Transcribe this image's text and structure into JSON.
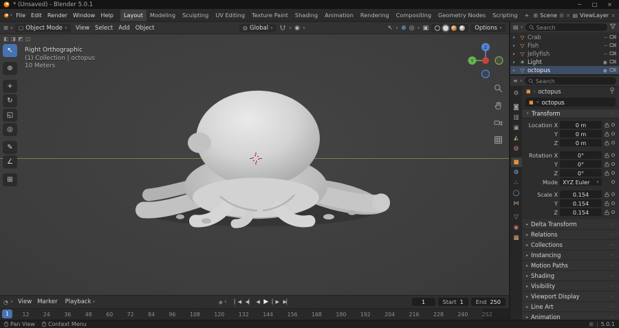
{
  "titlebar": {
    "title": "* (Unsaved) - Blender 5.0.1"
  },
  "menubar": {
    "menus": [
      {
        "label": "File"
      },
      {
        "label": "Edit"
      },
      {
        "label": "Render"
      },
      {
        "label": "Window"
      },
      {
        "label": "Help"
      }
    ],
    "workspaces": [
      {
        "label": "Layout",
        "active": true
      },
      {
        "label": "Modeling"
      },
      {
        "label": "Sculpting"
      },
      {
        "label": "UV Editing"
      },
      {
        "label": "Texture Paint"
      },
      {
        "label": "Shading"
      },
      {
        "label": "Animation"
      },
      {
        "label": "Rendering"
      },
      {
        "label": "Compositing"
      },
      {
        "label": "Geometry Nodes"
      },
      {
        "label": "Scripting"
      },
      {
        "label": "+"
      }
    ],
    "scene_label": "Scene",
    "viewlayer_label": "ViewLayer"
  },
  "viewport_header": {
    "mode": "Object Mode",
    "menus": [
      {
        "label": "View"
      },
      {
        "label": "Select"
      },
      {
        "label": "Add"
      },
      {
        "label": "Object"
      }
    ],
    "orientation": "Global",
    "options_label": "Options"
  },
  "toolbar": {
    "tools": [
      {
        "name": "select-box",
        "glyph": "↖",
        "active": true
      },
      {
        "name": "cursor",
        "glyph": "⊕",
        "gap": true
      },
      {
        "name": "move",
        "glyph": "+",
        "gap": true
      },
      {
        "name": "rotate",
        "glyph": "↻"
      },
      {
        "name": "scale",
        "glyph": "◱"
      },
      {
        "name": "transform",
        "glyph": "◎"
      },
      {
        "name": "annotate",
        "glyph": "✎",
        "gap": true
      },
      {
        "name": "measure",
        "glyph": "∠"
      },
      {
        "name": "add-cube",
        "glyph": "⊞",
        "gap": true
      }
    ]
  },
  "viewport": {
    "overlay": {
      "line1": "Right Orthographic",
      "line2": "(1) Collection | octopus",
      "line3": "10 Meters"
    }
  },
  "timeline": {
    "menus": [
      {
        "label": "View"
      },
      {
        "label": "Marker"
      }
    ],
    "playback_label": "Playback",
    "transport": [
      {
        "name": "jump-to-start",
        "glyph": "▏◀"
      },
      {
        "name": "previous-keyframe",
        "glyph": "◀▏"
      },
      {
        "name": "play-reverse",
        "glyph": "◀"
      },
      {
        "name": "play",
        "glyph": "▶",
        "play": true
      },
      {
        "name": "next-keyframe",
        "glyph": "▏▶"
      },
      {
        "name": "jump-to-end",
        "glyph": "▶▏"
      }
    ],
    "current_frame": "1",
    "start_label": "Start",
    "start_value": "1",
    "end_label": "End",
    "end_value": "250",
    "ruler": [
      "1",
      "12",
      "24",
      "36",
      "48",
      "60",
      "72",
      "84",
      "96",
      "108",
      "120",
      "132",
      "144",
      "156",
      "168",
      "180",
      "192",
      "204",
      "216",
      "228",
      "240",
      "252"
    ]
  },
  "outliner": {
    "search_placeholder": "Search",
    "items": [
      {
        "name": "Crab",
        "is_mesh": true,
        "hidden": true
      },
      {
        "name": "Fish",
        "is_mesh": true,
        "hidden": true
      },
      {
        "name": "Jellyfish",
        "is_mesh": true,
        "hidden": true
      },
      {
        "name": "Light",
        "is_light": true,
        "visible": true
      },
      {
        "name": "octopus",
        "is_mesh": true,
        "visible": true,
        "selected": true
      }
    ]
  },
  "properties": {
    "search_placeholder": "Search",
    "breadcrumb_object": "octopus",
    "object_name": "octopus",
    "transform_title": "Transform",
    "rows": [
      {
        "label": "Location X",
        "value": "0 m",
        "lock": true
      },
      {
        "label": "Y",
        "value": "0 m",
        "lock": true
      },
      {
        "label": "Z",
        "value": "0 m",
        "lock": true,
        "gap": true
      },
      {
        "label": "Rotation X",
        "value": "0°",
        "lock": true
      },
      {
        "label": "Y",
        "value": "0°",
        "lock": true
      },
      {
        "label": "Z",
        "value": "0°",
        "lock": true
      },
      {
        "label": "Mode",
        "value": "XYZ Euler",
        "dropdown": true,
        "gap": true
      },
      {
        "label": "Scale X",
        "value": "0.154",
        "lock": true
      },
      {
        "label": "Y",
        "value": "0.154",
        "lock": true
      },
      {
        "label": "Z",
        "value": "0.154",
        "lock": true
      }
    ],
    "sections": [
      {
        "label": "Delta Transform"
      },
      {
        "label": "Relations"
      },
      {
        "label": "Collections"
      },
      {
        "label": "Instancing"
      },
      {
        "label": "Motion Paths"
      },
      {
        "label": "Shading"
      },
      {
        "label": "Visibility"
      },
      {
        "label": "Viewport Display"
      },
      {
        "label": "Line Art"
      },
      {
        "label": "Animation"
      }
    ],
    "tabs": [
      {
        "name": "tool",
        "glyph": "⚙",
        "color": "#9e9e9e"
      },
      {
        "name": "render",
        "glyph": "◙",
        "color": "#9e9e9e",
        "gap": true
      },
      {
        "name": "output",
        "glyph": "▥",
        "color": "#9e9e9e"
      },
      {
        "name": "view-layer",
        "glyph": "▣",
        "color": "#9e9e9e"
      },
      {
        "name": "scene",
        "glyph": "◭",
        "color": "#c9a96a"
      },
      {
        "name": "world",
        "glyph": "◍",
        "color": "#cf8080"
      },
      {
        "name": "object",
        "glyph": "■",
        "color": "#e8913c",
        "active": true,
        "gap": true
      },
      {
        "name": "modifiers",
        "glyph": "⚙",
        "color": "#7fb2e5"
      },
      {
        "name": "particles",
        "glyph": "∴",
        "color": "#7fb2e5"
      },
      {
        "name": "physics",
        "glyph": "◯",
        "color": "#7fb2e5"
      },
      {
        "name": "constraints",
        "glyph": "⋈",
        "color": "#9e9e9e"
      },
      {
        "name": "object-data",
        "glyph": "▽",
        "color": "#74c26a",
        "gap": true
      },
      {
        "name": "material",
        "glyph": "◉",
        "color": "#d87070"
      },
      {
        "name": "texture",
        "glyph": "▩",
        "color": "#d8a870"
      }
    ]
  },
  "statusbar": {
    "left": "Pan View",
    "middle": "Context Menu",
    "version": "5.0.1"
  },
  "icons": {
    "minimize": "─",
    "maximize": "□",
    "close": "×",
    "caret": "∨",
    "chevron_right": "›",
    "expander": "▸",
    "eye": "◉",
    "eye_closed": "⌣",
    "mesh": "▽",
    "light": "☀",
    "list": "▤",
    "layers": "▤",
    "grid": "⊞",
    "clock": "◔",
    "properties": "≡",
    "object_mode": "▢",
    "orientation": "◍",
    "falloff": "◉",
    "select_cursor": "↖",
    "gizmo": "⊕",
    "overlays": "◎",
    "xray": "▣",
    "object_square": "■",
    "grip": "⋯",
    "keying": "◆",
    "duplicate": "⊞"
  },
  "colors": {
    "accent": "#4772b3",
    "selection_bg": "#3d4d66",
    "mesh_icon": "#e9a158",
    "axis_x": "#c4443f",
    "axis_y": "#67b34f",
    "axis_z": "#5585d6",
    "floor_line": "#7d7d4a"
  }
}
